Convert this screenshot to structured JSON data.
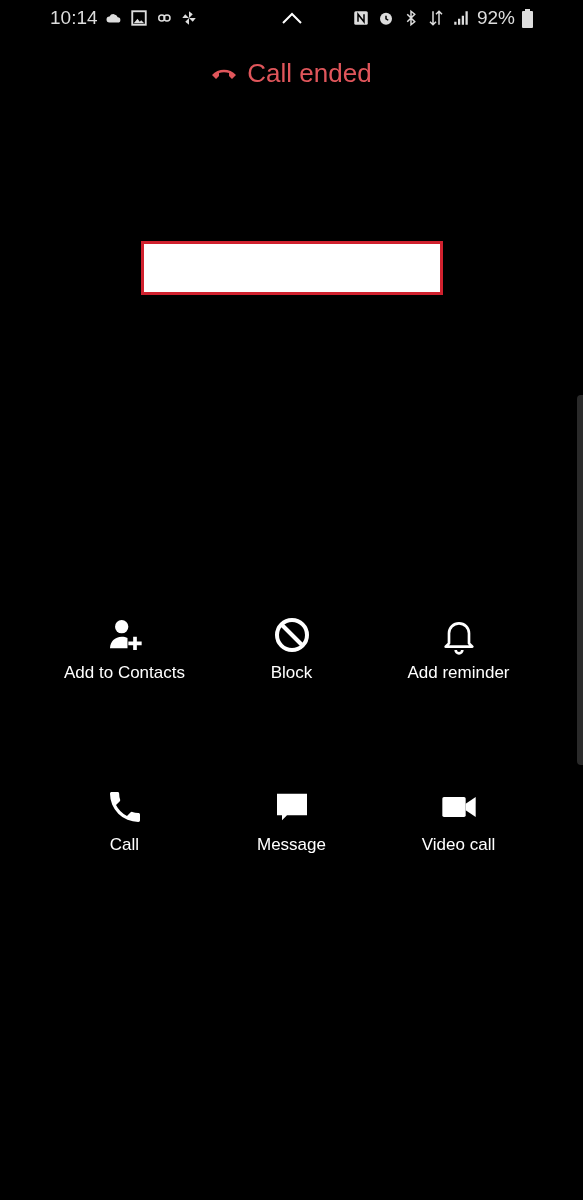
{
  "status_bar": {
    "time": "10:14",
    "battery": "92%"
  },
  "call_status": {
    "text": "Call ended"
  },
  "caller": {
    "kind": "redacted"
  },
  "actions": [
    {
      "label": "Add to Contacts",
      "kind": "add-contact"
    },
    {
      "label": "Block",
      "kind": "block"
    },
    {
      "label": "Add reminder",
      "kind": "reminder"
    },
    {
      "label": "Call",
      "kind": "call"
    },
    {
      "label": "Message",
      "kind": "message"
    },
    {
      "label": "Video call",
      "kind": "video"
    }
  ]
}
